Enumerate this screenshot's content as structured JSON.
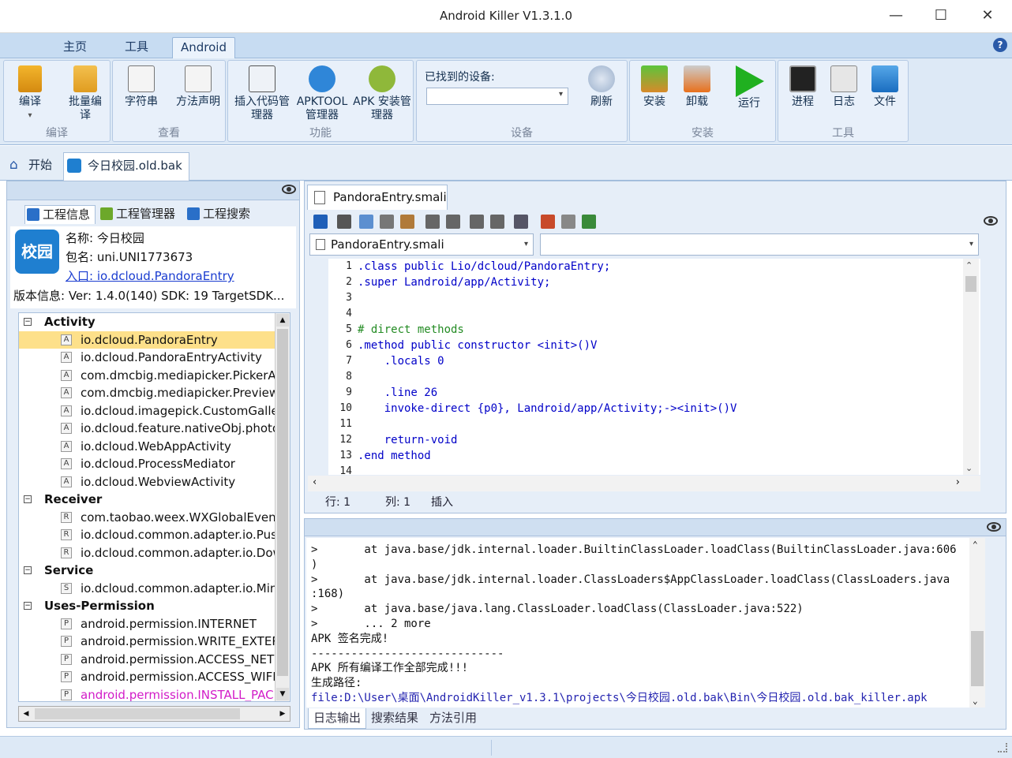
{
  "window": {
    "title": "Android Killer V1.3.1.0"
  },
  "menu": {
    "tabs": [
      "主页",
      "工具",
      "Android"
    ],
    "active": "Android"
  },
  "ribbon": {
    "groups": [
      {
        "label": "编译",
        "buttons": [
          "编译",
          "批量编译"
        ]
      },
      {
        "label": "查看",
        "buttons": [
          "字符串",
          "方法声明"
        ]
      },
      {
        "label": "功能",
        "buttons": [
          "插入代码管理器",
          "APKTOOL管理器",
          "APK 安装管理器"
        ]
      },
      {
        "label": "设备",
        "device_label": "已找到的设备:",
        "buttons": [
          "刷新"
        ]
      },
      {
        "label": "安装",
        "buttons": [
          "安装",
          "卸载",
          "运行"
        ]
      },
      {
        "label": "工具",
        "buttons": [
          "进程",
          "日志",
          "文件"
        ]
      }
    ]
  },
  "doc_tabs": [
    "开始",
    "今日校园.old.bak"
  ],
  "left": {
    "tabs": [
      "工程信息",
      "工程管理器",
      "工程搜索"
    ],
    "app": {
      "badge": "校园",
      "name": "名称: 今日校园",
      "package": "包名: uni.UNI1773673",
      "entry": "入口: io.dcloud.PandoraEntry",
      "version": "版本信息: Ver: 1.4.0(140) SDK: 19 TargetSDK..."
    },
    "tree": [
      {
        "type": "group",
        "label": "Activity"
      },
      {
        "type": "item",
        "badge": "A",
        "label": "io.dcloud.PandoraEntry",
        "selected": true
      },
      {
        "type": "item",
        "badge": "A",
        "label": "io.dcloud.PandoraEntryActivity"
      },
      {
        "type": "item",
        "badge": "A",
        "label": "com.dmcbig.mediapicker.PickerActivity"
      },
      {
        "type": "item",
        "badge": "A",
        "label": "com.dmcbig.mediapicker.PreviewActivity"
      },
      {
        "type": "item",
        "badge": "A",
        "label": "io.dcloud.imagepick.CustomGalleryActivity"
      },
      {
        "type": "item",
        "badge": "A",
        "label": "io.dcloud.feature.nativeObj.photoview"
      },
      {
        "type": "item",
        "badge": "A",
        "label": "io.dcloud.WebAppActivity"
      },
      {
        "type": "item",
        "badge": "A",
        "label": "io.dcloud.ProcessMediator"
      },
      {
        "type": "item",
        "badge": "A",
        "label": "io.dcloud.WebviewActivity"
      },
      {
        "type": "group",
        "label": "Receiver"
      },
      {
        "type": "item",
        "badge": "R",
        "label": "com.taobao.weex.WXGlobalEventReceiver"
      },
      {
        "type": "item",
        "badge": "R",
        "label": "io.dcloud.common.adapter.io.PushReceiver"
      },
      {
        "type": "item",
        "badge": "R",
        "label": "io.dcloud.common.adapter.io.DownloadReceiver"
      },
      {
        "type": "group",
        "label": "Service"
      },
      {
        "type": "item",
        "badge": "S",
        "label": "io.dcloud.common.adapter.io.MiniServerService"
      },
      {
        "type": "group",
        "label": "Uses-Permission"
      },
      {
        "type": "item",
        "badge": "P",
        "label": "android.permission.INTERNET"
      },
      {
        "type": "item",
        "badge": "P",
        "label": "android.permission.WRITE_EXTERNAL_STORAGE"
      },
      {
        "type": "item",
        "badge": "P",
        "label": "android.permission.ACCESS_NETWORK_STATE"
      },
      {
        "type": "item",
        "badge": "P",
        "label": "android.permission.ACCESS_WIFI_STATE"
      },
      {
        "type": "item",
        "badge": "P",
        "label": "android.permission.INSTALL_PACKAGES",
        "highlight": true
      }
    ]
  },
  "editor": {
    "file_tab": "PandoraEntry.smali",
    "file_combo": "PandoraEntry.smali",
    "lines": [
      {
        "n": "1",
        "t": ".class public Lio/dcloud/PandoraEntry;",
        "k": "dir"
      },
      {
        "n": "2",
        "t": ".super Landroid/app/Activity;",
        "k": "dir"
      },
      {
        "n": "3",
        "t": ""
      },
      {
        "n": "4",
        "t": ""
      },
      {
        "n": "5",
        "t": "# direct methods",
        "k": "cm"
      },
      {
        "n": "6",
        "t": ".method public constructor <init>()V",
        "k": "dir"
      },
      {
        "n": "7",
        "t": "    .locals 0",
        "k": "dir"
      },
      {
        "n": "8",
        "t": ""
      },
      {
        "n": "9",
        "t": "    .line 26",
        "k": "dir"
      },
      {
        "n": "10",
        "t": "    invoke-direct {p0}, Landroid/app/Activity;-><init>()V",
        "k": "dir"
      },
      {
        "n": "11",
        "t": ""
      },
      {
        "n": "12",
        "t": "    return-void",
        "k": "dir"
      },
      {
        "n": "13",
        "t": ".end method",
        "k": "dir"
      },
      {
        "n": "14",
        "t": ""
      }
    ],
    "status": {
      "row": "行: 1",
      "col": "列: 1",
      "mode": "插入"
    }
  },
  "log": {
    "lines": [
      ">       at java.base/jdk.internal.loader.BuiltinClassLoader.loadClass(BuiltinClassLoader.java:606",
      ")",
      ">       at java.base/jdk.internal.loader.ClassLoaders$AppClassLoader.loadClass(ClassLoaders.java",
      ":168)",
      ">       at java.base/java.lang.ClassLoader.loadClass(ClassLoader.java:522)",
      ">       ... 2 more",
      "APK 签名完成!",
      "-----------------------------",
      "APK 所有编译工作全部完成!!!",
      "生成路径:",
      "file:D:\\User\\桌面\\AndroidKiller_v1.3.1\\projects\\今日校园.old.bak\\Bin\\今日校园.old.bak_killer.apk"
    ],
    "tabs": [
      "日志输出",
      "搜索结果",
      "方法引用"
    ]
  }
}
